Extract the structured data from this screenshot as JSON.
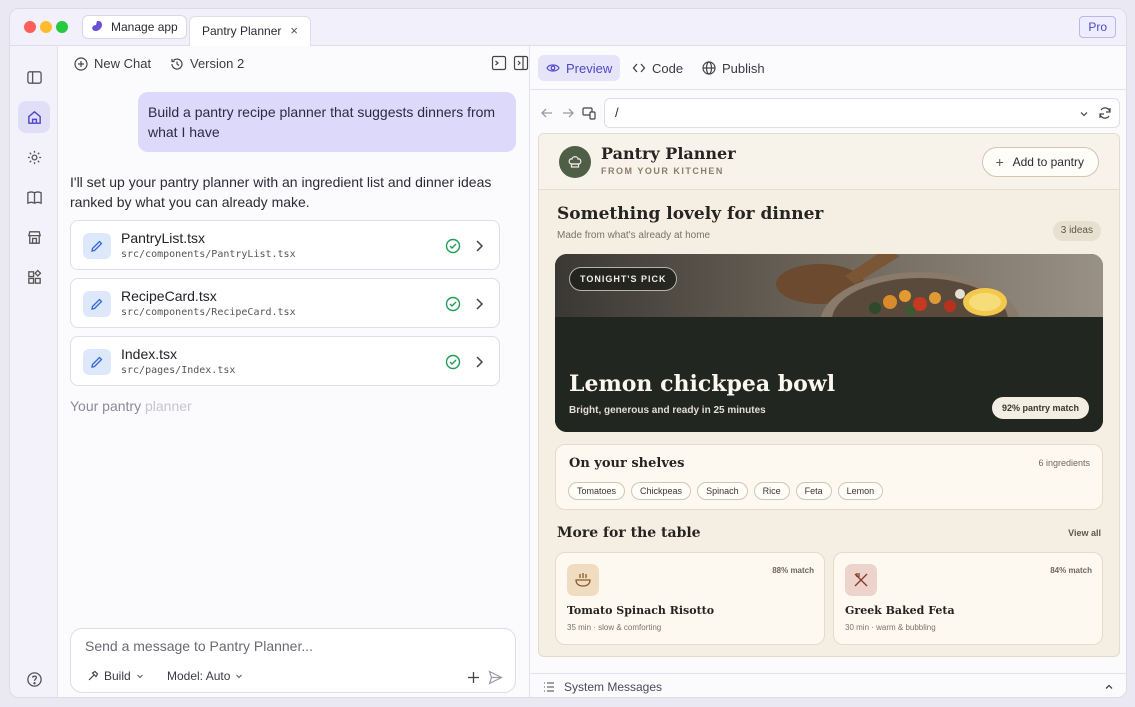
{
  "window": {
    "manage_label": "Manage app",
    "tab_title": "Pantry Planner",
    "tab_close": "×",
    "plan_badge": "Pro"
  },
  "rail": {
    "items": [
      "sidebar-toggle-icon",
      "home-icon",
      "settings-icon",
      "book-icon",
      "store-icon",
      "apps-icon",
      "help-icon"
    ],
    "active": "home-icon"
  },
  "chat": {
    "new_chat_label": "New Chat",
    "version_label": "Version 2",
    "user_message": "Build a pantry recipe planner that suggests dinners from what I have",
    "assistant_message": "I'll set up your pantry planner with an ingredient list and dinner ideas ranked by what you can already make.",
    "files": [
      {
        "name": "PantryList.tsx",
        "path": "src/components/PantryList.tsx"
      },
      {
        "name": "RecipeCard.tsx",
        "path": "src/components/RecipeCard.tsx"
      },
      {
        "name": "Index.tsx",
        "path": "src/pages/Index.tsx"
      }
    ],
    "streaming_text": "Your pantry",
    "streaming_fade": "planner",
    "composer_placeholder": "Send a message to Pantry Planner...",
    "mode_label": "Build",
    "model_label": "Model: Auto"
  },
  "preview": {
    "tabs": [
      "Preview",
      "Code",
      "Publish"
    ],
    "active_tab": "Preview",
    "address": "/",
    "system_messages_label": "System Messages"
  },
  "site": {
    "brand_name": "Pantry Planner",
    "brand_tagline": "FROM YOUR KITCHEN",
    "add_button": "Add to pantry",
    "headline": "Something lovely for dinner",
    "subheadline": "Made from what's already at home",
    "ideas_count": "3 ideas",
    "hero": {
      "badge": "TONIGHT'S PICK",
      "title": "Lemon chickpea bowl",
      "subtitle": "Bright, generous and ready in 25 minutes",
      "match": "92% pantry match"
    },
    "shelves": {
      "title": "On your shelves",
      "count": "6 ingredients",
      "ingredients": [
        "Tomatoes",
        "Chickpeas",
        "Spinach",
        "Rice",
        "Feta",
        "Lemon"
      ]
    },
    "more": {
      "title": "More for the table",
      "view_all": "View all",
      "recipes": [
        {
          "name": "Tomato Spinach Risotto",
          "meta": "35 min · slow & comforting",
          "match": "88% match",
          "icon": "bowl-icon"
        },
        {
          "name": "Greek Baked Feta",
          "meta": "30 min · warm & bubbling",
          "match": "84% match",
          "icon": "utensils-icon"
        }
      ]
    }
  },
  "colors": {
    "accent": "#4f46c8",
    "user_bubble": "#dcd9fb",
    "site_bg": "#f4eee3",
    "brand_green": "#4f5e47",
    "success": "#1f9d55"
  }
}
